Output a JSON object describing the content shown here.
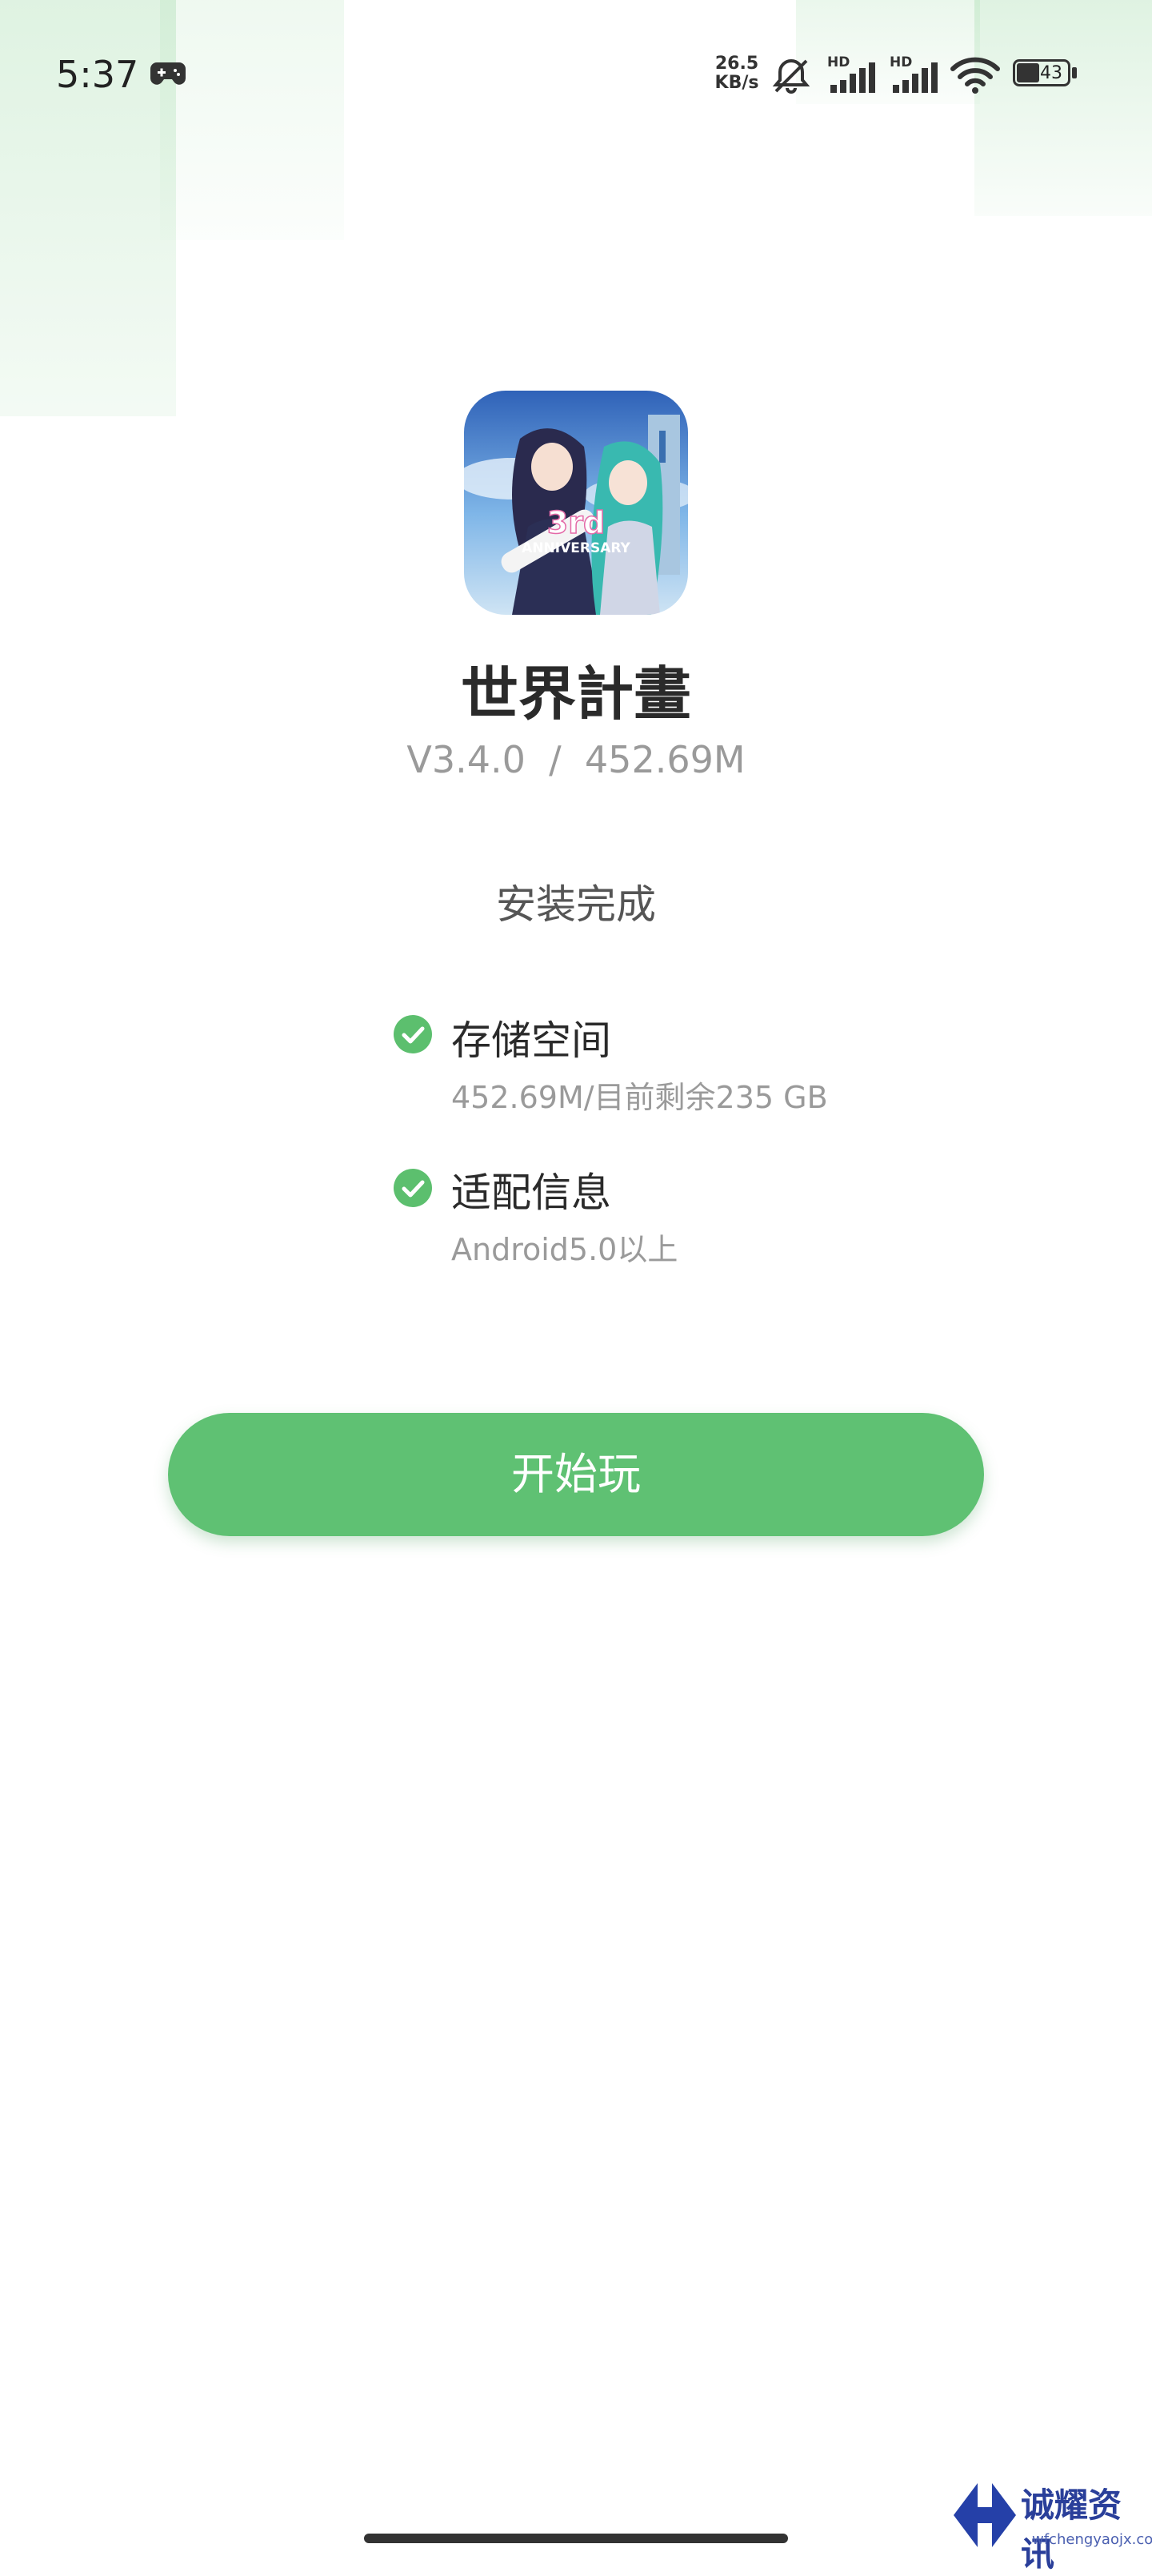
{
  "status_bar": {
    "time": "5:37",
    "speed_value": "26.5",
    "speed_unit": "KB/s",
    "signal1_label": "HD",
    "signal2_label": "HD",
    "battery": "43",
    "icons": [
      "gamepad-icon",
      "bell-muted-icon",
      "signal-icon",
      "signal-icon",
      "wifi-icon",
      "battery-icon"
    ]
  },
  "app": {
    "name": "世界計畫",
    "version_line": "V3.4.0  /  452.69M",
    "icon_text": "ANNIVERSARY"
  },
  "install": {
    "status": "安装完成"
  },
  "requirements": [
    {
      "title": "存储空间",
      "detail": "452.69M/目前剩余235 GB"
    },
    {
      "title": "适配信息",
      "detail": "Android5.0以上"
    }
  ],
  "play_button": {
    "label": "开始玩"
  },
  "watermark": {
    "text": "诚耀资讯",
    "url": "wfchengyaojx.com"
  },
  "colors": {
    "accent": "#5fc173",
    "check": "#5cbf6e",
    "title": "#2a2a2a",
    "muted": "#9a9a9a"
  }
}
